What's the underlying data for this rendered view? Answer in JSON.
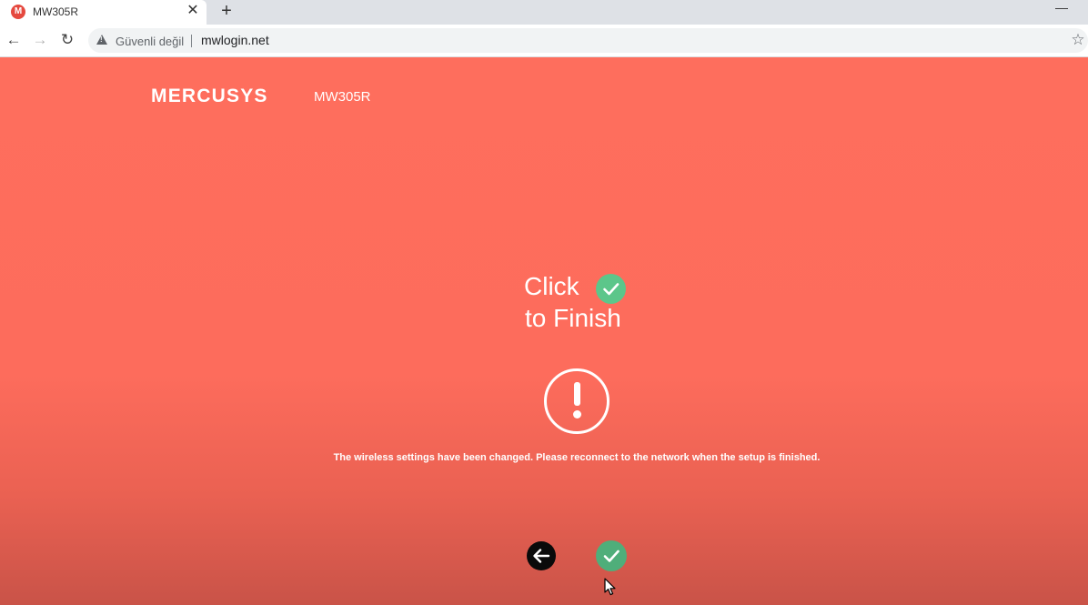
{
  "browser": {
    "tab": {
      "title": "MW305R",
      "favicon_letter": "M",
      "close_glyph": "✕"
    },
    "new_tab_glyph": "+",
    "minimize_glyph": "—",
    "nav": {
      "back_glyph": "←",
      "forward_glyph": "→",
      "reload_glyph": "↻"
    },
    "address_bar": {
      "security_text": "Güvenli değil",
      "url": "mwlogin.net"
    },
    "bookmark_glyph": "☆"
  },
  "page": {
    "logo": "MERCUSYS",
    "model": "MW305R",
    "instruction_line1": "Click",
    "instruction_line2": "to Finish",
    "notice": "The wireless settings have been changed. Please reconnect to the network when the setup is finished.",
    "icons": {
      "warning": "exclamation-circle-icon",
      "back": "arrow-left-icon",
      "finish": "checkmark-icon"
    }
  },
  "colors": {
    "page_background": "#fe6e5d",
    "check_accent": "#5cc68a",
    "back_button": "#0a0a0a",
    "favicon": "#e5493f"
  }
}
